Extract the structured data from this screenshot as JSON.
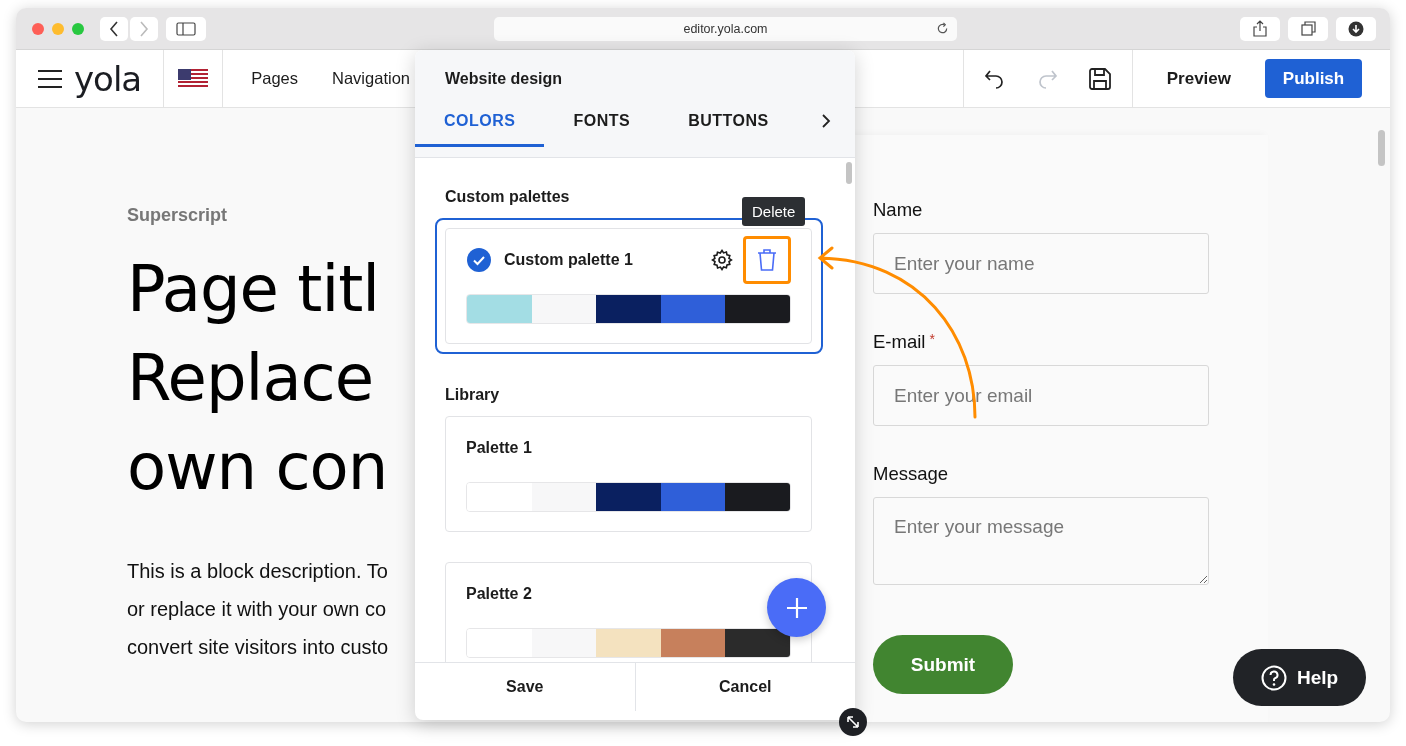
{
  "browser": {
    "url": "editor.yola.com"
  },
  "toolbar": {
    "logo": "yola",
    "nav": [
      "Pages",
      "Navigation"
    ],
    "redo_disabled": true,
    "preview": "Preview",
    "publish": "Publish"
  },
  "page": {
    "superscript": "Superscript",
    "title_lines": [
      "Page titl",
      "Replace",
      "own con"
    ],
    "description_lines": [
      "This is a block description. To",
      "or replace it with your own co",
      "convert site visitors into custo"
    ]
  },
  "form": {
    "fields": [
      {
        "kind": "input",
        "label": "Name",
        "placeholder": "Enter your name"
      },
      {
        "kind": "input",
        "label": "E-mail",
        "required_mark": "*",
        "placeholder": "Enter your email"
      },
      {
        "kind": "textarea",
        "label": "Message",
        "placeholder": "Enter your message"
      }
    ],
    "submit": "Submit"
  },
  "help": {
    "label": "Help"
  },
  "panel": {
    "title": "Website design",
    "tabs": [
      {
        "label": "COLORS",
        "selected": true
      },
      {
        "label": "FONTS",
        "selected": false
      },
      {
        "label": "BUTTONS",
        "selected": false
      }
    ],
    "custom_title": "Custom palettes",
    "custom_palettes": [
      {
        "name": "Custom palette 1",
        "selected": true,
        "swatches": [
          {
            "color": "#a3dde4"
          },
          {
            "color": "#f7f7f8"
          },
          {
            "color": "#0a2060"
          },
          {
            "color": "#2f5fd9"
          },
          {
            "color": "#1a1b1f"
          }
        ]
      }
    ],
    "tooltip": "Delete",
    "library_title": "Library",
    "library": [
      {
        "name": "Palette 1",
        "selected": false,
        "swatches": [
          {
            "color": "#ffffff"
          },
          {
            "color": "#f7f7f8"
          },
          {
            "color": "#0a2060"
          },
          {
            "color": "#2f5fd9"
          },
          {
            "color": "#1a1b1f"
          }
        ]
      },
      {
        "name": "Palette 2",
        "selected": false,
        "swatches": [
          {
            "color": "#ffffff"
          },
          {
            "color": "#f7f7f8"
          },
          {
            "color": "#f4e2bf"
          },
          {
            "color": "#c7805c"
          },
          {
            "color": "#2b2b2b"
          }
        ]
      }
    ],
    "buttons": [
      "Save",
      "Cancel"
    ]
  }
}
